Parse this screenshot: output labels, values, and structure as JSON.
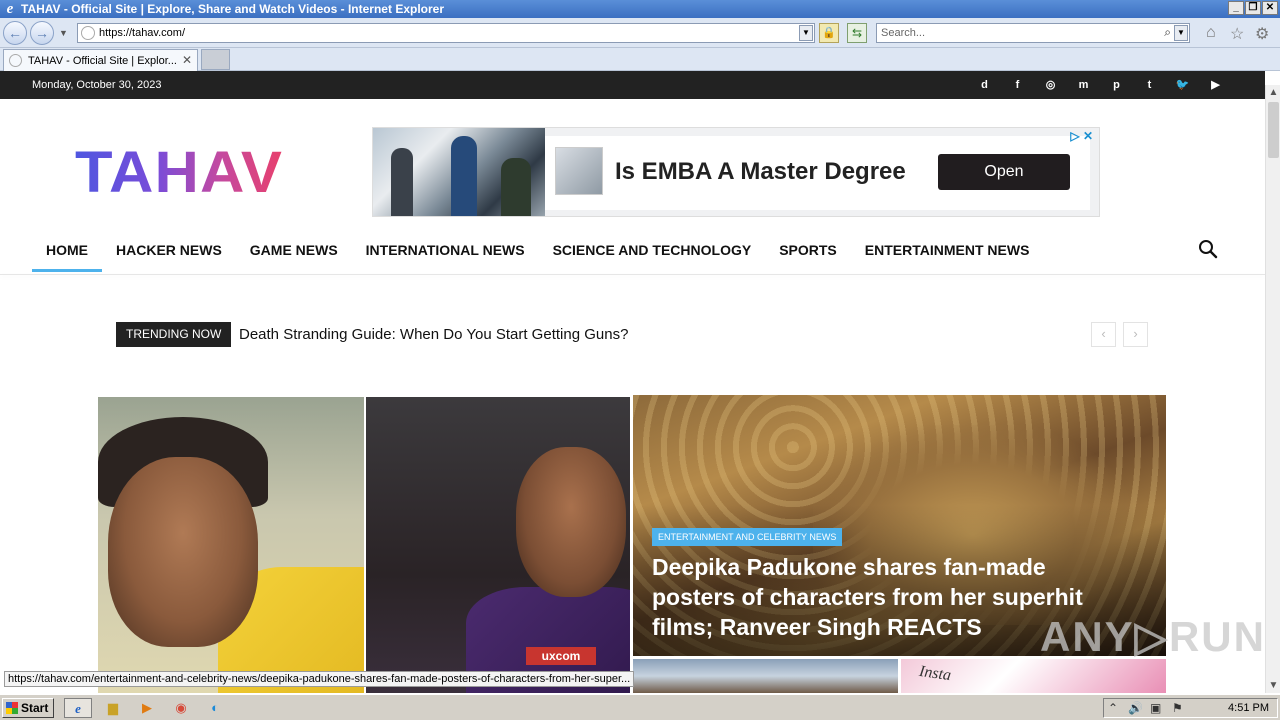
{
  "browser": {
    "window_title": "TAHAV - Official Site | Explore, Share and Watch Videos - Internet Explorer",
    "address": "https://tahav.com/",
    "search_placeholder": "Search...",
    "tab_title": "TAHAV - Official Site | Explor...",
    "status_url": "https://tahav.com/entertainment-and-celebrity-news/deepika-padukone-shares-fan-made-posters-of-characters-from-her-super..."
  },
  "topbar": {
    "date": "Monday, October 30, 2023",
    "social": [
      {
        "name": "discord-icon",
        "glyph": "d"
      },
      {
        "name": "facebook-icon",
        "glyph": "f"
      },
      {
        "name": "instagram-icon",
        "glyph": "◎"
      },
      {
        "name": "mix-icon",
        "glyph": "m"
      },
      {
        "name": "pinterest-icon",
        "glyph": "p"
      },
      {
        "name": "tumblr-icon",
        "glyph": "t"
      },
      {
        "name": "twitter-icon",
        "glyph": "🐦"
      },
      {
        "name": "youtube-icon",
        "glyph": "▶"
      }
    ]
  },
  "header": {
    "logo": "TAHAV",
    "ad": {
      "headline": "Is EMBA A Master Degree",
      "button": "Open"
    }
  },
  "nav": {
    "items": [
      {
        "label": "HOME",
        "active": true
      },
      {
        "label": "HACKER NEWS",
        "active": false
      },
      {
        "label": "GAME NEWS",
        "active": false
      },
      {
        "label": "INTERNATIONAL NEWS",
        "active": false
      },
      {
        "label": "SCIENCE AND TECHNOLOGY",
        "active": false
      },
      {
        "label": "SPORTS",
        "active": false
      },
      {
        "label": "ENTERTAINMENT NEWS",
        "active": false
      }
    ]
  },
  "trending": {
    "label": "TRENDING NOW",
    "headline": "Death Stranding Guide: When Do You Start Getting Guns?",
    "prev": "‹",
    "next": "›"
  },
  "featured": {
    "main": {
      "category": "ENTERTAINMENT AND CELEBRITY NEWS",
      "title": "Deepika Padukone shares fan-made posters of characters from her superhit films; Ranveer Singh REACTS"
    },
    "jersey_text": "uxcom",
    "small_text": "Insta"
  },
  "watermark": "ANY▷RUN",
  "taskbar": {
    "start": "Start",
    "clock": "4:51 PM"
  },
  "colors": {
    "accent": "#4db2ec",
    "topbar": "#222222",
    "ad_button": "#211d1f"
  }
}
